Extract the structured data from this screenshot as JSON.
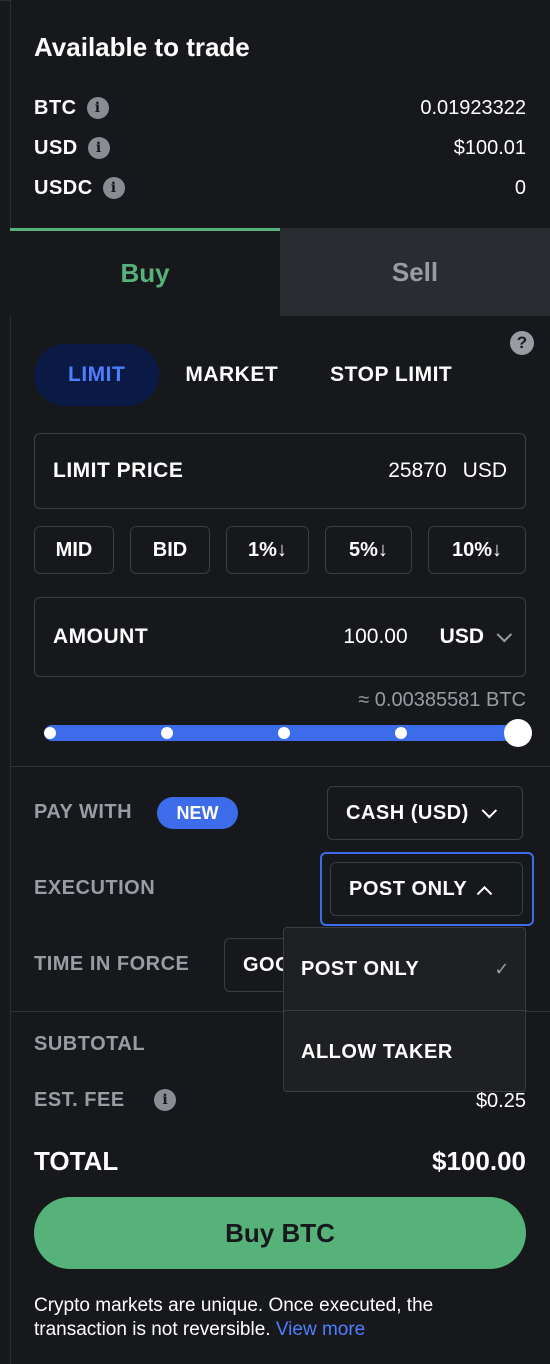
{
  "balances": {
    "title": "Available to trade",
    "rows": [
      {
        "asset": "BTC",
        "value": "0.01923322"
      },
      {
        "asset": "USD",
        "value": "$100.01"
      },
      {
        "asset": "USDC",
        "value": "0"
      }
    ]
  },
  "side_tabs": {
    "buy": "Buy",
    "sell": "Sell",
    "active": "Buy"
  },
  "order_types": {
    "items": [
      "LIMIT",
      "MARKET",
      "STOP LIMIT"
    ],
    "active": "LIMIT"
  },
  "limit_price": {
    "label": "LIMIT PRICE",
    "value": "25870",
    "unit": "USD"
  },
  "quick_prices": [
    "MID",
    "BID",
    "1%↓",
    "5%↓",
    "10%↓"
  ],
  "amount": {
    "label": "AMOUNT",
    "value": "100.00",
    "currency": "USD",
    "approx": "≈ 0.00385581 BTC"
  },
  "slider": {
    "level": 1.0
  },
  "pay_with": {
    "label": "PAY WITH",
    "badge": "NEW",
    "selected": "CASH (USD)"
  },
  "execution": {
    "label": "EXECUTION",
    "selected": "POST ONLY",
    "options": [
      "POST ONLY",
      "ALLOW TAKER"
    ],
    "check_glyph": "✓"
  },
  "time_in_force": {
    "label": "TIME IN FORCE",
    "selected_partial": "GOO"
  },
  "summary": {
    "subtotal_label": "SUBTOTAL",
    "fee_label": "EST. FEE",
    "fee_value": "$0.25",
    "total_label": "TOTAL",
    "total_value": "$100.00"
  },
  "buy_button": "Buy BTC",
  "disclaimer": {
    "text": "Crypto markets are unique. Once executed, the transaction is not reversible.",
    "link": "View more"
  },
  "colors": {
    "accent_green": "#57b27a",
    "accent_blue": "#3d6cea",
    "background": "#17181c"
  },
  "icons": {
    "info": "info-icon",
    "help": "help-icon",
    "chevron": "chevron-down-icon",
    "check": "check-icon"
  }
}
